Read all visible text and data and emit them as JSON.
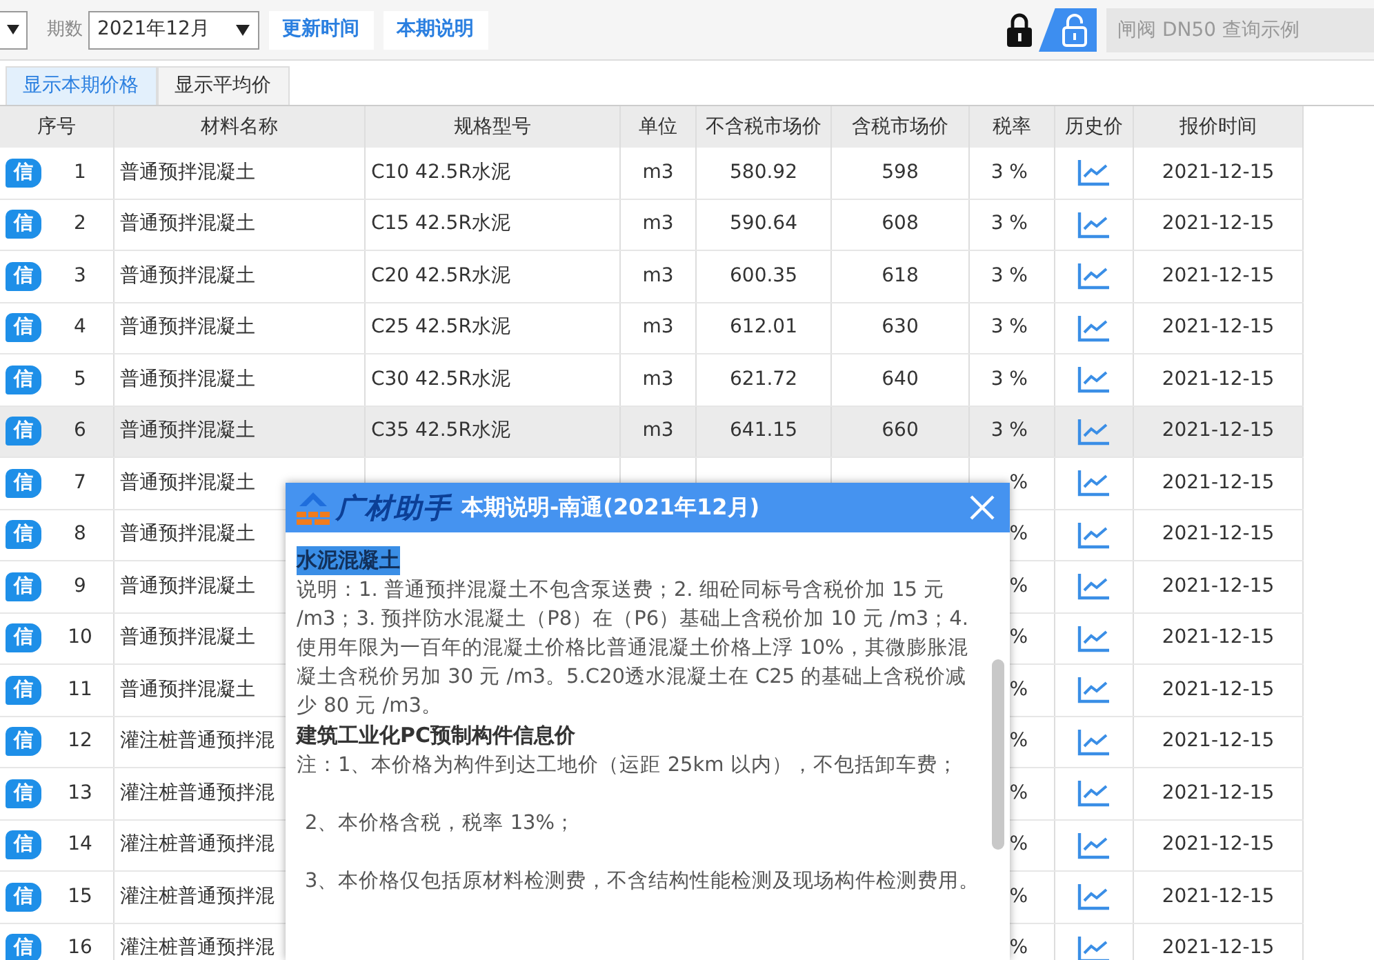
{
  "toolbar": {
    "period_label": "期数",
    "period_value": "2021年12月",
    "buttons": [
      "更新时间",
      "本期说明"
    ],
    "search": {
      "placeholder": "闸阀 DN50 查询示例"
    }
  },
  "tabs": [
    {
      "label": "显示本期价格",
      "selected": true
    },
    {
      "label": "显示平均价",
      "selected": false
    }
  ],
  "table": {
    "columns": [
      "序号",
      "材料名称",
      "规格型号",
      "单位",
      "不含税市场价",
      "含税市场价",
      "税率",
      "历史价",
      "报价时间"
    ],
    "rows": [
      {
        "badge": "信",
        "no": "1",
        "material": "普通预拌混凝土",
        "spec": "C10 42.5R水泥",
        "unit": "m3",
        "price_ex_tax": "580.92",
        "price_inc_tax": "598",
        "tax_rate": "3 %",
        "date": "2021-12-15",
        "selected": false
      },
      {
        "badge": "信",
        "no": "2",
        "material": "普通预拌混凝土",
        "spec": "C15 42.5R水泥",
        "unit": "m3",
        "price_ex_tax": "590.64",
        "price_inc_tax": "608",
        "tax_rate": "3 %",
        "date": "2021-12-15",
        "selected": false
      },
      {
        "badge": "信",
        "no": "3",
        "material": "普通预拌混凝土",
        "spec": "C20 42.5R水泥",
        "unit": "m3",
        "price_ex_tax": "600.35",
        "price_inc_tax": "618",
        "tax_rate": "3 %",
        "date": "2021-12-15",
        "selected": false
      },
      {
        "badge": "信",
        "no": "4",
        "material": "普通预拌混凝土",
        "spec": "C25 42.5R水泥",
        "unit": "m3",
        "price_ex_tax": "612.01",
        "price_inc_tax": "630",
        "tax_rate": "3 %",
        "date": "2021-12-15",
        "selected": false
      },
      {
        "badge": "信",
        "no": "5",
        "material": "普通预拌混凝土",
        "spec": "C30 42.5R水泥",
        "unit": "m3",
        "price_ex_tax": "621.72",
        "price_inc_tax": "640",
        "tax_rate": "3 %",
        "date": "2021-12-15",
        "selected": false
      },
      {
        "badge": "信",
        "no": "6",
        "material": "普通预拌混凝土",
        "spec": "C35 42.5R水泥",
        "unit": "m3",
        "price_ex_tax": "641.15",
        "price_inc_tax": "660",
        "tax_rate": "3 %",
        "date": "2021-12-15",
        "selected": true
      },
      {
        "badge": "信",
        "no": "7",
        "material": "普通预拌混凝土",
        "tax_rate": "%",
        "date": "2021-12-15",
        "selected": false
      },
      {
        "badge": "信",
        "no": "8",
        "material": "普通预拌混凝土",
        "tax_rate": "%",
        "date": "2021-12-15",
        "selected": false
      },
      {
        "badge": "信",
        "no": "9",
        "material": "普通预拌混凝土",
        "tax_rate": "%",
        "date": "2021-12-15",
        "selected": false
      },
      {
        "badge": "信",
        "no": "10",
        "material": "普通预拌混凝土",
        "tax_rate": "%",
        "date": "2021-12-15",
        "selected": false
      },
      {
        "badge": "信",
        "no": "11",
        "material": "普通预拌混凝土",
        "tax_rate": "%",
        "date": "2021-12-15",
        "selected": false
      },
      {
        "badge": "信",
        "no": "12",
        "material": "灌注桩普通预拌混",
        "tax_rate": "%",
        "date": "2021-12-15",
        "selected": false
      },
      {
        "badge": "信",
        "no": "13",
        "material": "灌注桩普通预拌混",
        "tax_rate": "%",
        "date": "2021-12-15",
        "selected": false
      },
      {
        "badge": "信",
        "no": "14",
        "material": "灌注桩普通预拌混",
        "tax_rate": "%",
        "date": "2021-12-15",
        "selected": false
      },
      {
        "badge": "信",
        "no": "15",
        "material": "灌注桩普通预拌混",
        "tax_rate": "%",
        "date": "2021-12-15",
        "selected": false
      },
      {
        "badge": "信",
        "no": "16",
        "material": "灌注桩普通预拌混",
        "tax_rate": "%",
        "date": "2021-12-15",
        "selected": false
      }
    ]
  },
  "dialog": {
    "logo": "广材助手",
    "title": "本期说明-南通(2021年12月)",
    "sections": [
      {
        "heading": "水泥混凝土",
        "heading_selected": true,
        "paragraphs": [
          "说明：1. 普通预拌混凝土不包含泵送费；2. 细砼同标号含税价加 15 元 /m3；3. 预拌防水混凝土（P8）在（P6）基础上含税价加 10 元 /m3；4. 使用年限为一百年的混凝土价格比普通混凝土价格上浮 10%，其微膨胀混凝土含税价另加 30 元 /m3。5.C20透水混凝土在 C25 的基础上含税价减少 80 元 /m3。"
        ]
      },
      {
        "heading": "建筑工业化PC预制构件信息价",
        "heading_selected": false,
        "paragraphs": [
          "注：1、本价格为构件到达工地价（运距 25km 以内），不包括卸车费；",
          "2、本价格含税，税率 13%；",
          "3、本价格仅包括原材料检测费，不含结构性能检测及现场构件检测费用。"
        ]
      }
    ]
  }
}
